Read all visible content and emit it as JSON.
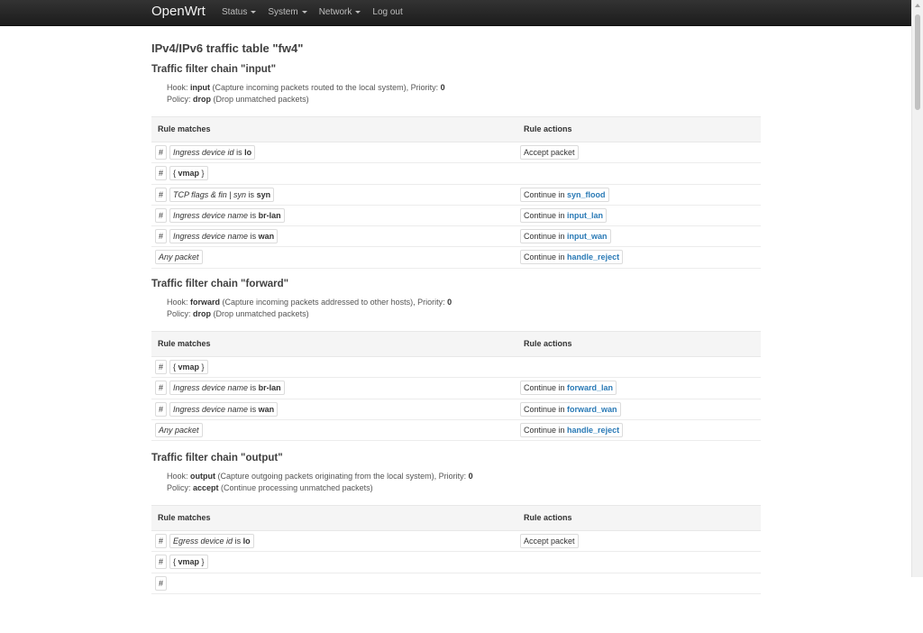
{
  "nav": {
    "brand": "OpenWrt",
    "menus": [
      "Status",
      "System",
      "Network"
    ],
    "logout": "Log out"
  },
  "page_title": "IPv4/IPv6 traffic table \"fw4\"",
  "labels": {
    "hook": "Hook:",
    "priority": ", Priority:",
    "policy": "Policy:",
    "is": "is",
    "hash": "#",
    "continue_in": "Continue in",
    "rule_matches": "Rule matches",
    "rule_actions": "Rule actions",
    "brace_open": "{",
    "brace_close": "}",
    "vmap": "vmap"
  },
  "chains": [
    {
      "title": "Traffic filter chain \"input\"",
      "hook": "input",
      "hook_desc": "(Capture incoming packets routed to the local system)",
      "priority": "0",
      "policy": "drop",
      "policy_desc": "(Drop unmatched packets)",
      "rows": [
        {
          "match_key": "Ingress device id",
          "match_val": "lo",
          "action": "Accept packet"
        },
        {
          "vmap": true
        },
        {
          "match_key": "TCP flags & fin | syn",
          "match_val": "syn",
          "continue": "syn_flood"
        },
        {
          "match_key": "Ingress device name",
          "match_val": "br-lan",
          "continue": "input_lan"
        },
        {
          "match_key": "Ingress device name",
          "match_val": "wan",
          "continue": "input_wan"
        },
        {
          "any": "Any packet",
          "continue": "handle_reject"
        }
      ]
    },
    {
      "title": "Traffic filter chain \"forward\"",
      "hook": "forward",
      "hook_desc": "(Capture incoming packets addressed to other hosts)",
      "priority": "0",
      "policy": "drop",
      "policy_desc": "(Drop unmatched packets)",
      "rows": [
        {
          "vmap": true
        },
        {
          "match_key": "Ingress device name",
          "match_val": "br-lan",
          "continue": "forward_lan"
        },
        {
          "match_key": "Ingress device name",
          "match_val": "wan",
          "continue": "forward_wan"
        },
        {
          "any": "Any packet",
          "continue": "handle_reject"
        }
      ]
    },
    {
      "title": "Traffic filter chain \"output\"",
      "hook": "output",
      "hook_desc": "(Capture outgoing packets originating from the local system)",
      "priority": "0",
      "policy": "accept",
      "policy_desc": "(Continue processing unmatched packets)",
      "rows": [
        {
          "match_key": "Egress device id",
          "match_val": "lo",
          "action": "Accept packet"
        },
        {
          "vmap": true
        },
        {
          "partial": true
        }
      ]
    }
  ]
}
